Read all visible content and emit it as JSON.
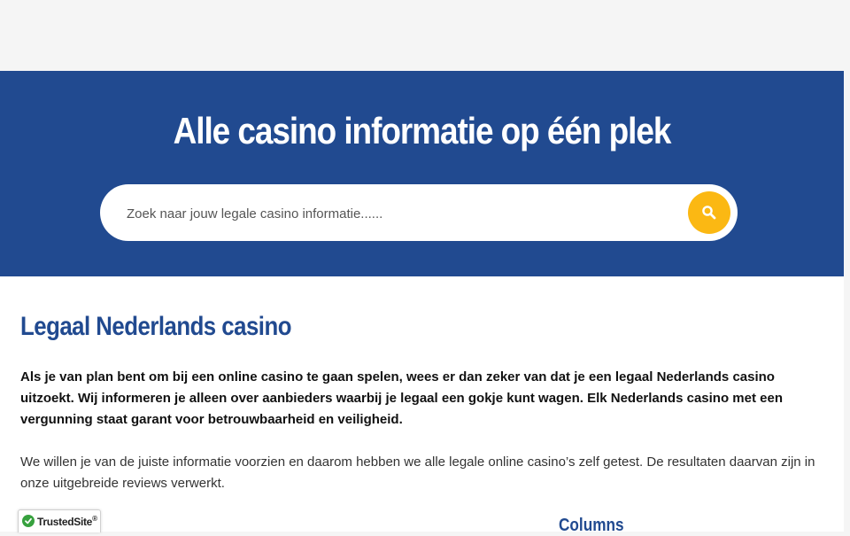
{
  "hero": {
    "title": "Alle casino informatie op één plek",
    "background_color": "#214a90"
  },
  "search": {
    "placeholder": "Zoek naar jouw legale casino informatie......",
    "button_icon": "search-icon",
    "button_color": "#fbb813"
  },
  "main": {
    "heading": "Legaal Nederlands casino",
    "intro_bold": "Als je van plan bent om bij een online casino te gaan spelen, wees er dan zeker van dat je een legaal Nederlands casino uitzoekt. Wij informeren je alleen over aanbieders waarbij je legaal een gokje kunt wagen. Elk Nederlands casino met een vergunning staat garant voor betrouwbaarheid en veiligheid.",
    "intro_normal": "We willen je van de juiste informatie voorzien en daarom hebben we alle legale online casino’s zelf getest. De resultaten daarvan zijn in onze uitgebreide reviews verwerkt.",
    "columns_heading": "Columns"
  },
  "trusted_badge": {
    "label": "TrustedSite",
    "mark": "®",
    "icon": "checkmark-icon"
  }
}
